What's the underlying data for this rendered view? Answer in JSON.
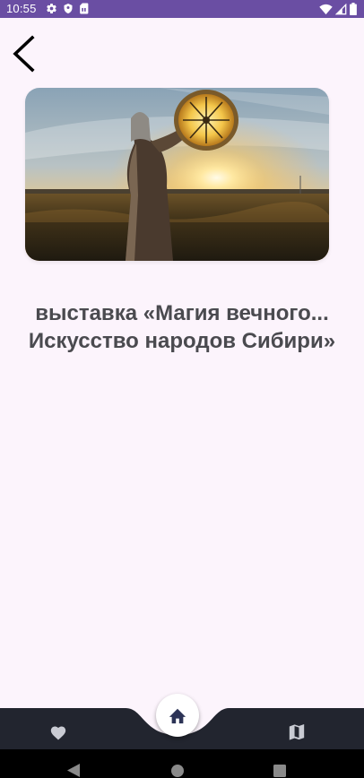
{
  "status_bar": {
    "time": "10:55",
    "background": "#6a4ea3",
    "left_icons": [
      "settings-gear-icon",
      "shield-icon",
      "sim-card-icon"
    ],
    "right_icons": [
      "wifi-icon",
      "signal-icon",
      "battery-icon"
    ]
  },
  "toolbar": {
    "back_icon": "arrow-back-icon"
  },
  "event": {
    "image_alt": "shaman-drum-sunset-photo",
    "title_line1": "выставка «Магия вечного...",
    "title_line2": "Искусство народов Сибири»"
  },
  "bottom_nav": {
    "background": "#22252f",
    "items": [
      {
        "icon": "heart-icon"
      },
      {
        "icon": "home-icon",
        "selected": true
      },
      {
        "icon": "map-icon"
      }
    ]
  },
  "system_nav": {
    "buttons": [
      "nav-back-triangle-icon",
      "nav-home-circle-icon",
      "nav-recents-square-icon"
    ]
  }
}
